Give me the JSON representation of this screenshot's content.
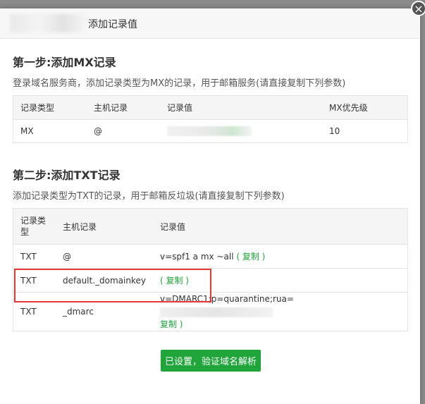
{
  "dialog": {
    "title": "添加记录值",
    "close": "×"
  },
  "step1": {
    "heading": "第一步:添加MX记录",
    "desc": "登录域名服务商，添加记录类型为MX的记录，用于邮箱服务(请直接复制下列参数)",
    "headers": [
      "记录类型",
      "主机记录",
      "记录值",
      "MX优先级"
    ],
    "row": {
      "type": "MX",
      "host": "@",
      "priority": "10"
    }
  },
  "step2": {
    "heading": "第二步:添加TXT记录",
    "desc": "添加记录类型为TXT的记录，用于邮箱反垃圾(请直接复制下列参数)",
    "headers": [
      "记录类型",
      "主机记录",
      "记录值"
    ],
    "rows": [
      {
        "type": "TXT",
        "host": "@",
        "value": "v=spf1 a mx ~all",
        "copy": "( 复制 )"
      },
      {
        "type": "TXT",
        "host": "default._domainkey",
        "value": "",
        "copy": "( 复制 )"
      },
      {
        "type": "TXT",
        "host": "_dmarc",
        "value": "v=DMARC1;p=quarantine;rua=",
        "copy": "复制 )"
      }
    ]
  },
  "verify_button": "已设置，验证域名解析",
  "colors": {
    "accent": "#20a53a",
    "highlight": "#e53935"
  }
}
